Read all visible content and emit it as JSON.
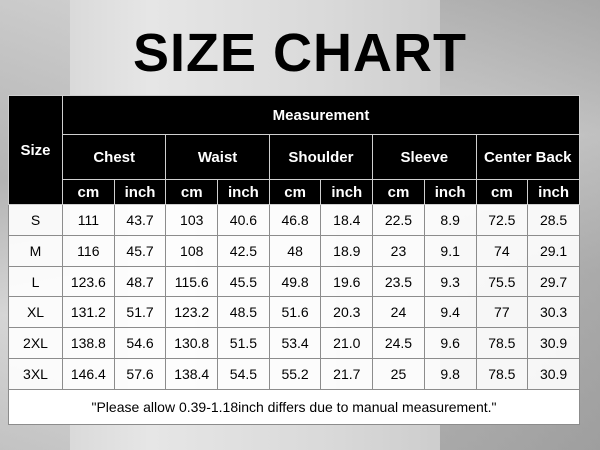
{
  "title": "SIZE CHART",
  "header": {
    "size": "Size",
    "measurement": "Measurement",
    "groups": [
      "Chest",
      "Waist",
      "Shoulder",
      "Sleeve",
      "Center Back"
    ],
    "units": [
      "cm",
      "inch"
    ]
  },
  "rows": [
    {
      "size": "S",
      "values": [
        "111",
        "43.7",
        "103",
        "40.6",
        "46.8",
        "18.4",
        "22.5",
        "8.9",
        "72.5",
        "28.5"
      ]
    },
    {
      "size": "M",
      "values": [
        "116",
        "45.7",
        "108",
        "42.5",
        "48",
        "18.9",
        "23",
        "9.1",
        "74",
        "29.1"
      ]
    },
    {
      "size": "L",
      "values": [
        "123.6",
        "48.7",
        "115.6",
        "45.5",
        "49.8",
        "19.6",
        "23.5",
        "9.3",
        "75.5",
        "29.7"
      ]
    },
    {
      "size": "XL",
      "values": [
        "131.2",
        "51.7",
        "123.2",
        "48.5",
        "51.6",
        "20.3",
        "24",
        "9.4",
        "77",
        "30.3"
      ]
    },
    {
      "size": "2XL",
      "values": [
        "138.8",
        "54.6",
        "130.8",
        "51.5",
        "53.4",
        "21.0",
        "24.5",
        "9.6",
        "78.5",
        "30.9"
      ]
    },
    {
      "size": "3XL",
      "values": [
        "146.4",
        "57.6",
        "138.4",
        "54.5",
        "55.2",
        "21.7",
        "25",
        "9.8",
        "78.5",
        "30.9"
      ]
    }
  ],
  "note": "\"Please allow 0.39-1.18inch differs due to manual measurement.\""
}
